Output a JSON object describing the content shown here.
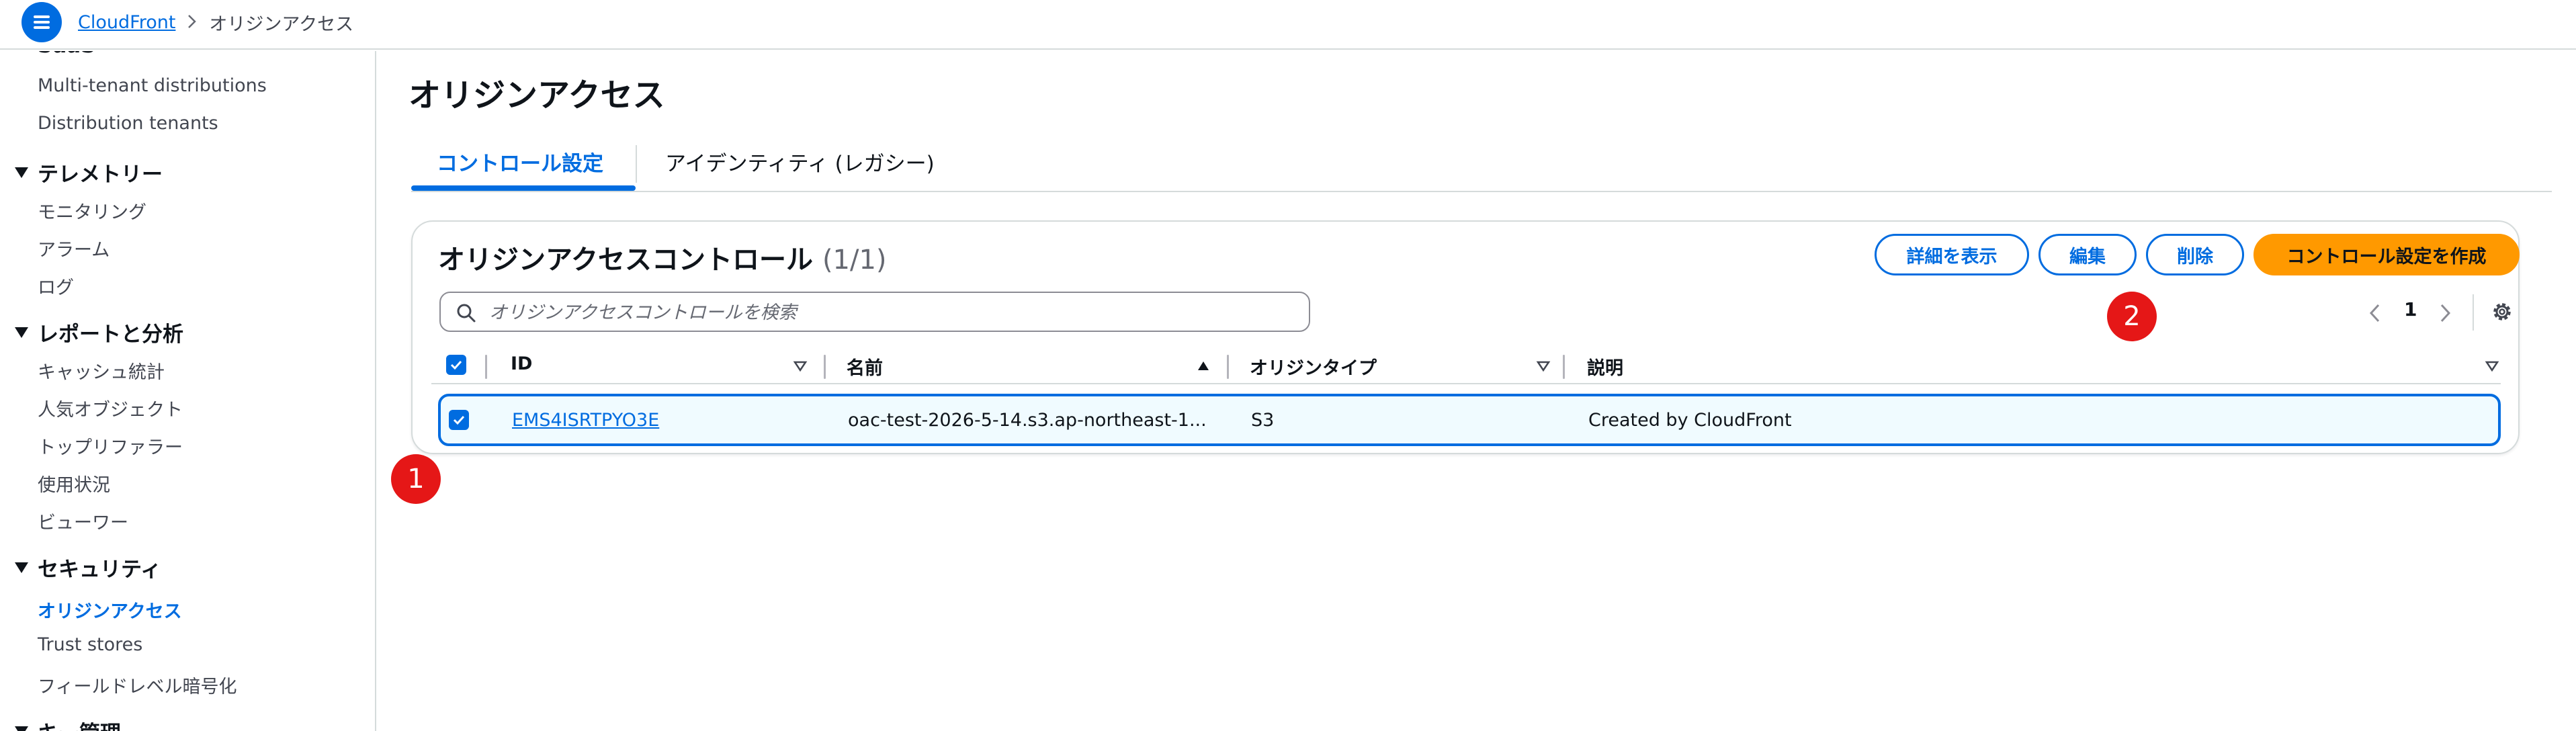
{
  "breadcrumb": {
    "root": "CloudFront",
    "current": "オリジンアクセス"
  },
  "sidebar": {
    "partial_top": "SaaS",
    "saas_items": [
      "Multi-tenant distributions",
      "Distribution tenants"
    ],
    "telemetry": {
      "heading": "テレメトリー",
      "items": [
        "モニタリング",
        "アラーム",
        "ログ"
      ]
    },
    "reports": {
      "heading": "レポートと分析",
      "items": [
        "キャッシュ統計",
        "人気オブジェクト",
        "トップリファラー",
        "使用状況",
        "ビューワー"
      ]
    },
    "security": {
      "heading": "セキュリティ",
      "items": [
        "オリジンアクセス",
        "Trust stores",
        "フィールドレベル暗号化"
      ],
      "active": "オリジンアクセス"
    },
    "partial_bottom": "キー管理"
  },
  "page": {
    "title": "オリジンアクセス"
  },
  "tabs": [
    {
      "label": "コントロール設定",
      "active": true
    },
    {
      "label": "アイデンティティ (レガシー)",
      "active": false
    }
  ],
  "table": {
    "title": "オリジンアクセスコントロール",
    "count": "(1/1)",
    "buttons": {
      "view_details": "詳細を表示",
      "edit": "編集",
      "delete": "削除",
      "create": "コントロール設定を作成"
    },
    "search": {
      "placeholder": "オリジンアクセスコントロールを検索",
      "value": ""
    },
    "pagination": {
      "current_page": "1"
    },
    "columns": [
      "ID",
      "名前",
      "オリジンタイプ",
      "説明"
    ],
    "rows": [
      {
        "id": "EMS4ISRTPYO3E",
        "name": "oac-test-2026-5-14.s3.ap-northeast-1...",
        "origin_type": "S3",
        "description": "Created by CloudFront",
        "selected": true
      }
    ]
  },
  "annotations": {
    "badge_1": "1",
    "badge_2": "2"
  },
  "colors": {
    "accent": "#006ce0",
    "primary_button": "#ff9900",
    "badge": "#e51717"
  },
  "icons": [
    "hamburger-menu-icon",
    "chevron-right-icon",
    "caret-down-icon",
    "search-icon",
    "chevron-left-icon",
    "gear-icon",
    "sort-desc-icon",
    "sort-asc-icon",
    "checkmark-icon"
  ]
}
